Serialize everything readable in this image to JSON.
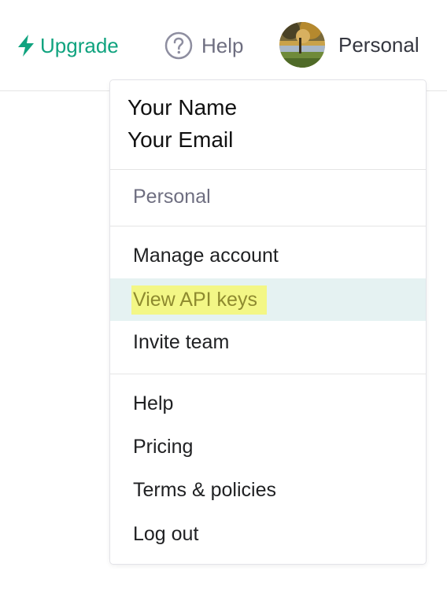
{
  "topbar": {
    "upgrade_label": "Upgrade",
    "upgrade_icon": "lightning-bolt-icon",
    "help_label": "Help",
    "help_icon": "question-circle-icon",
    "account_label": "Personal",
    "accent_color": "#10a37f"
  },
  "menu": {
    "user_name": "Your Name",
    "user_email": "Your Email",
    "org_label": "Personal",
    "account_items": [
      "Manage account",
      "View API keys",
      "Invite team"
    ],
    "active_item": "View API keys",
    "footer_items": [
      "Help",
      "Pricing",
      "Terms & policies",
      "Log out"
    ]
  }
}
